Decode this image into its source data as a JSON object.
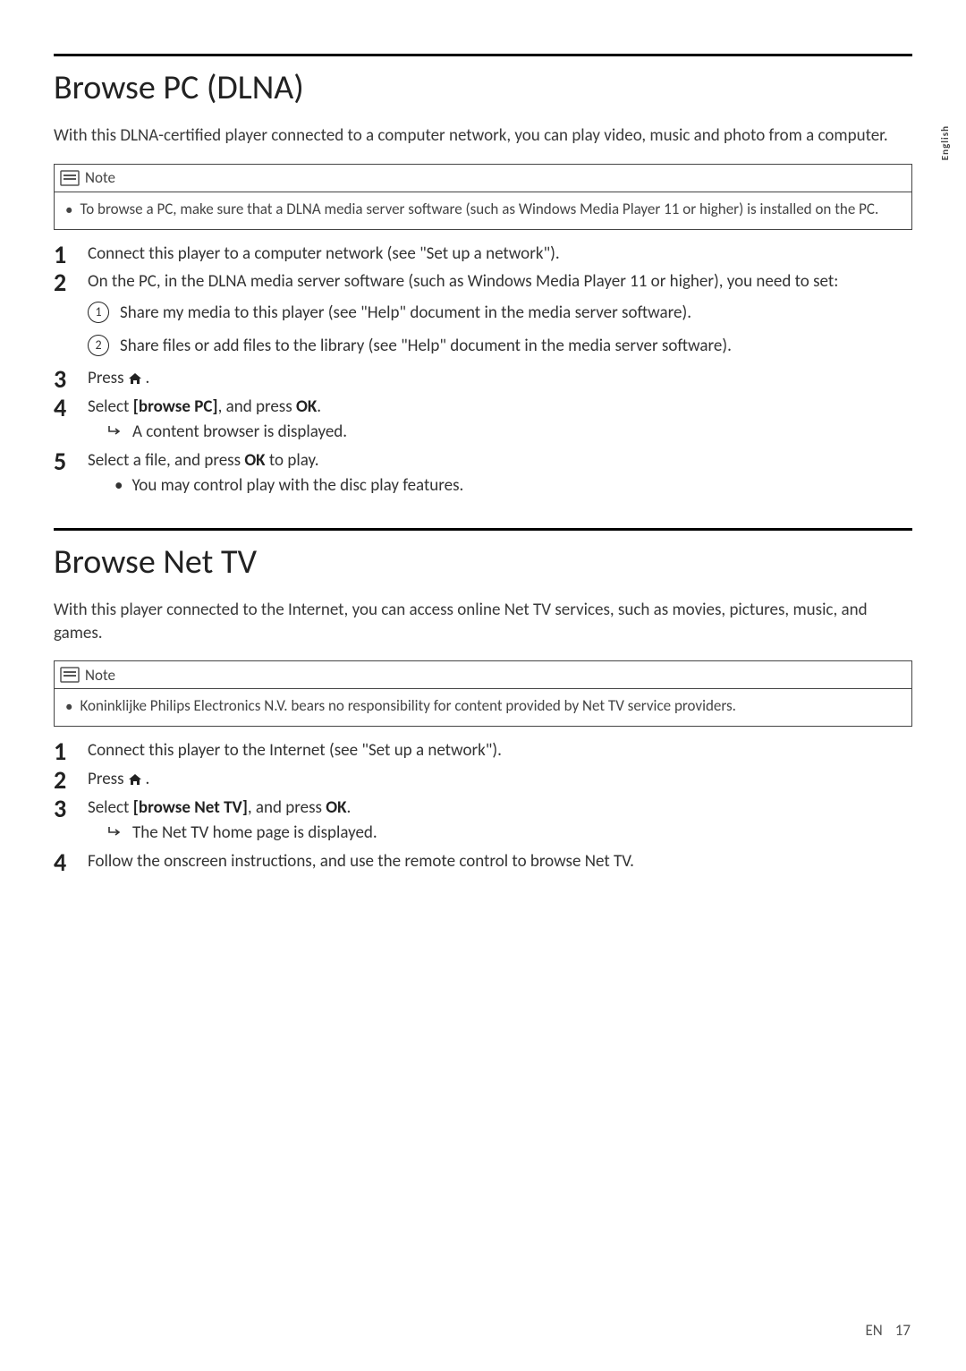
{
  "side_label": "English",
  "section1": {
    "title": "Browse PC (DLNA)",
    "intro": "With this DLNA-certified player connected to a computer network, you can play video, music and photo from a computer.",
    "note_label": "Note",
    "note_text": "To browse a PC, make sure that a DLNA media server software (such as Windows Media Player 11 or higher) is installed on the PC.",
    "step1": "Connect this player to a computer network (see \"Set up a network\").",
    "step2_lead": "On the PC, in the DLNA media server software (such as Windows Media Player 11 or higher), you need to set:",
    "step2_sub1": "Share my media to this player (see \"Help\" document in the media server software).",
    "step2_sub2": "Share files or add files to the library (see \"Help\" document in the media server software).",
    "step3_prefix": "Press ",
    "step3_suffix": ".",
    "step4_prefix": "Select ",
    "step4_label": "[browse PC]",
    "step4_mid": ", and press ",
    "step4_ok": "OK",
    "step4_suffix": ".",
    "step4_result": "A content browser is displayed.",
    "step5_prefix": "Select a file, and press ",
    "step5_ok": "OK",
    "step5_suffix": " to play.",
    "step5_bullet": "You may control play with the disc play features."
  },
  "section2": {
    "title": "Browse Net TV",
    "intro": "With this player connected to the Internet, you can access online Net TV services, such as movies, pictures, music, and games.",
    "note_label": "Note",
    "note_text": "Koninklijke Philips Electronics N.V. bears no responsibility for content provided by Net TV service providers.",
    "step1": "Connect this player to the Internet (see \"Set up a network\").",
    "step2_prefix": "Press ",
    "step2_suffix": ".",
    "step3_prefix": "Select ",
    "step3_label": "[browse Net TV]",
    "step3_mid": ", and press ",
    "step3_ok": "OK",
    "step3_suffix": ".",
    "step3_result": "The Net TV home page is displayed.",
    "step4": "Follow the onscreen instructions, and use the remote control to browse Net TV."
  },
  "footer": {
    "lang": "EN",
    "page": "17"
  }
}
